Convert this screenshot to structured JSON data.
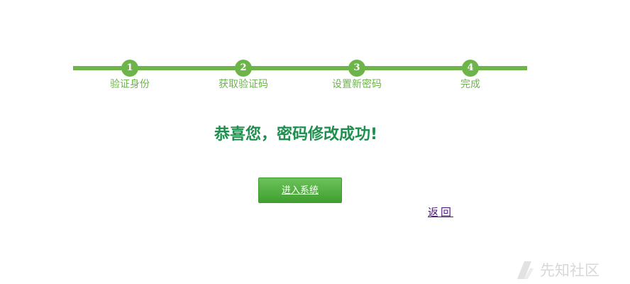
{
  "steps": [
    {
      "number": "1",
      "label": "验证身份"
    },
    {
      "number": "2",
      "label": "获取验证码"
    },
    {
      "number": "3",
      "label": "设置新密码"
    },
    {
      "number": "4",
      "label": "完成"
    }
  ],
  "message": "恭喜您，密码修改成功!",
  "enter_button": "进入系统",
  "back_link": "返回",
  "watermark": {
    "text": "先知社区",
    "logo_icon": "xianzhi-logo-icon"
  },
  "colors": {
    "step_green": "#6db44b",
    "message_green": "#1f8f4e",
    "link_purple": "#4b1b7a",
    "watermark_gray": "#d8d8d8"
  }
}
